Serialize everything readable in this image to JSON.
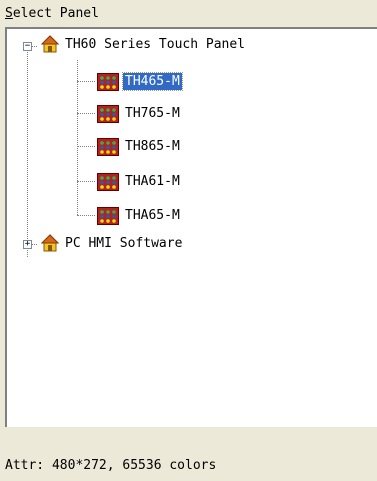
{
  "panel": {
    "title_accel": "S",
    "title_rest": "elect Panel"
  },
  "tree": {
    "groups": [
      {
        "label": "TH60 Series Touch Panel",
        "expanded": true,
        "children": [
          {
            "label": "TH465-M",
            "selected": true
          },
          {
            "label": "TH765-M",
            "selected": false
          },
          {
            "label": "TH865-M",
            "selected": false
          },
          {
            "label": "THA61-M",
            "selected": false
          },
          {
            "label": "THA65-M",
            "selected": false
          }
        ]
      },
      {
        "label": "PC HMI Software",
        "expanded": false,
        "children": []
      }
    ],
    "expander_collapse": "−",
    "expander_expand": "+"
  },
  "status": {
    "attr": "Attr: 480*272, 65536 colors"
  },
  "colors": {
    "selection": "#316ac5",
    "background": "#ece9d8"
  }
}
